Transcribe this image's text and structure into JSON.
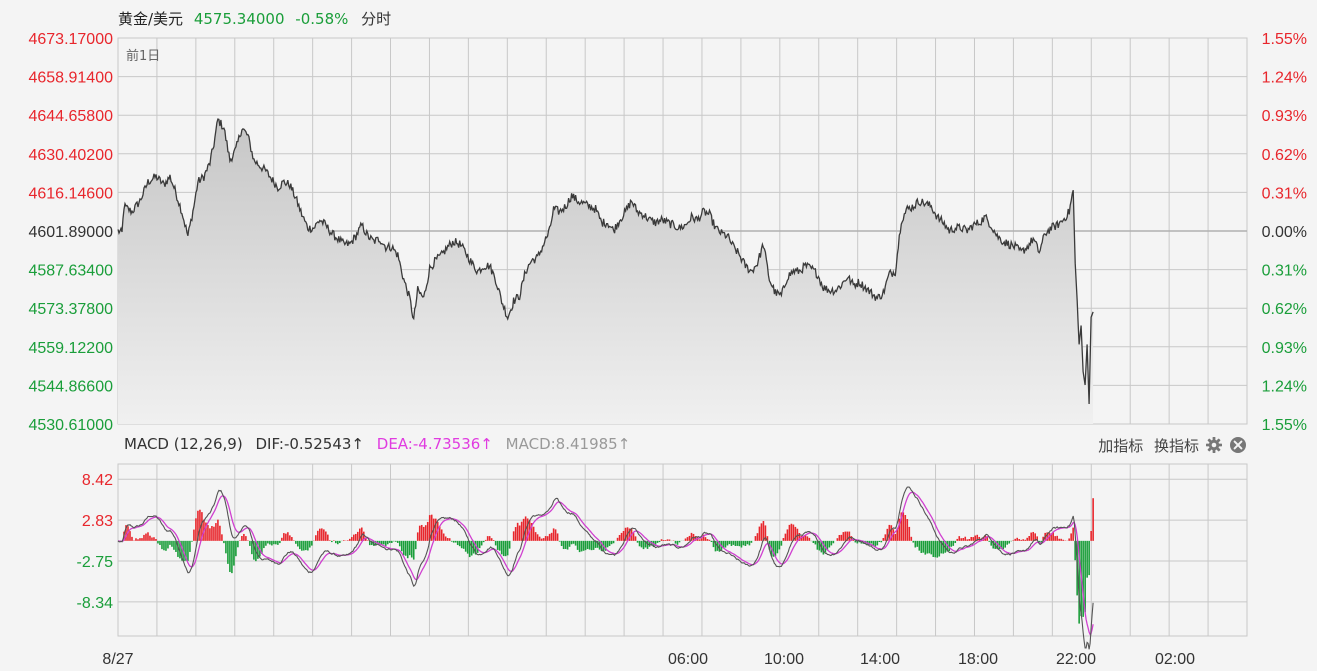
{
  "header": {
    "symbol": "黄金/美元",
    "price": "4575.34000",
    "change_pct": "-0.58%",
    "period": "分时",
    "prev_day_label": "前1日"
  },
  "macd_header": {
    "title": "MACD (12,26,9)",
    "dif": "DIF:-0.52543↑",
    "dea": "DEA:-4.73536↑",
    "macd": "MACD:8.41985↑",
    "add_indicator": "加指标",
    "switch_indicator": "换指标"
  },
  "colors": {
    "up": "#e8262c",
    "down": "#1a9e3a",
    "line": "#3a3a3a",
    "dea": "#d040d0",
    "dif": "#555555",
    "grid": "#c8c8c8"
  },
  "chart_data": [
    {
      "type": "line",
      "name": "price",
      "x_labels": [
        "8/27",
        "06:00",
        "10:00",
        "14:00",
        "18:00",
        "22:00",
        "02:00"
      ],
      "y_ticks_left": [
        "4673.17000",
        "4658.91400",
        "4644.65800",
        "4630.40200",
        "4616.14600",
        "4601.89000",
        "4587.63400",
        "4573.37800",
        "4559.12200",
        "4544.86600",
        "4530.61000"
      ],
      "y_ticks_right": [
        "1.55%",
        "1.24%",
        "0.93%",
        "0.62%",
        "0.31%",
        "0.00%",
        "0.31%",
        "0.62%",
        "0.93%",
        "1.24%",
        "1.55%"
      ],
      "ylim": [
        4530.61,
        4673.17
      ],
      "base": 4601.89,
      "keypoints": [
        [
          0,
          4602
        ],
        [
          4,
          4601
        ],
        [
          6,
          4611
        ],
        [
          14,
          4609
        ],
        [
          22,
          4613
        ],
        [
          30,
          4620
        ],
        [
          38,
          4622
        ],
        [
          46,
          4619
        ],
        [
          52,
          4622
        ],
        [
          58,
          4616
        ],
        [
          64,
          4609
        ],
        [
          70,
          4600
        ],
        [
          76,
          4611
        ],
        [
          80,
          4620
        ],
        [
          86,
          4622
        ],
        [
          92,
          4627
        ],
        [
          96,
          4634
        ],
        [
          100,
          4643
        ],
        [
          106,
          4640
        ],
        [
          112,
          4628
        ],
        [
          118,
          4632
        ],
        [
          124,
          4640
        ],
        [
          130,
          4637
        ],
        [
          136,
          4628
        ],
        [
          142,
          4626
        ],
        [
          148,
          4624
        ],
        [
          154,
          4621
        ],
        [
          160,
          4618
        ],
        [
          166,
          4620
        ],
        [
          172,
          4619
        ],
        [
          178,
          4614
        ],
        [
          184,
          4608
        ],
        [
          190,
          4603
        ],
        [
          196,
          4603
        ],
        [
          202,
          4606
        ],
        [
          208,
          4604
        ],
        [
          214,
          4601
        ],
        [
          220,
          4599
        ],
        [
          226,
          4597
        ],
        [
          232,
          4597
        ],
        [
          238,
          4600
        ],
        [
          244,
          4604
        ],
        [
          250,
          4600
        ],
        [
          256,
          4598
        ],
        [
          262,
          4599
        ],
        [
          268,
          4596
        ],
        [
          274,
          4596
        ],
        [
          280,
          4593
        ],
        [
          286,
          4584
        ],
        [
          292,
          4577
        ],
        [
          296,
          4569
        ],
        [
          300,
          4580
        ],
        [
          306,
          4577
        ],
        [
          312,
          4588
        ],
        [
          318,
          4591
        ],
        [
          324,
          4593
        ],
        [
          330,
          4596
        ],
        [
          336,
          4598
        ],
        [
          342,
          4597
        ],
        [
          348,
          4594
        ],
        [
          354,
          4590
        ],
        [
          360,
          4587
        ],
        [
          366,
          4589
        ],
        [
          372,
          4589
        ],
        [
          378,
          4584
        ],
        [
          384,
          4576
        ],
        [
          390,
          4570
        ],
        [
          396,
          4576
        ],
        [
          402,
          4578
        ],
        [
          408,
          4587
        ],
        [
          414,
          4591
        ],
        [
          420,
          4592
        ],
        [
          426,
          4597
        ],
        [
          432,
          4602
        ],
        [
          436,
          4610
        ],
        [
          442,
          4609
        ],
        [
          448,
          4611
        ],
        [
          454,
          4615
        ],
        [
          460,
          4613
        ],
        [
          466,
          4612
        ],
        [
          472,
          4611
        ],
        [
          478,
          4610
        ],
        [
          484,
          4605
        ],
        [
          490,
          4605
        ],
        [
          496,
          4602
        ],
        [
          502,
          4606
        ],
        [
          508,
          4609
        ],
        [
          514,
          4613
        ],
        [
          520,
          4609
        ],
        [
          526,
          4608
        ],
        [
          532,
          4606
        ],
        [
          538,
          4605
        ],
        [
          544,
          4606
        ],
        [
          550,
          4605
        ],
        [
          556,
          4604
        ],
        [
          562,
          4603
        ],
        [
          568,
          4604
        ],
        [
          574,
          4607
        ],
        [
          580,
          4606
        ],
        [
          586,
          4609
        ],
        [
          592,
          4608
        ],
        [
          598,
          4603
        ],
        [
          604,
          4601
        ],
        [
          610,
          4600
        ],
        [
          616,
          4596
        ],
        [
          622,
          4593
        ],
        [
          628,
          4589
        ],
        [
          634,
          4587
        ],
        [
          640,
          4590
        ],
        [
          646,
          4597
        ],
        [
          652,
          4584
        ],
        [
          658,
          4579
        ],
        [
          664,
          4578
        ],
        [
          670,
          4585
        ],
        [
          676,
          4587
        ],
        [
          682,
          4587
        ],
        [
          688,
          4589
        ],
        [
          694,
          4588
        ],
        [
          700,
          4586
        ],
        [
          706,
          4581
        ],
        [
          712,
          4580
        ],
        [
          718,
          4580
        ],
        [
          724,
          4582
        ],
        [
          730,
          4585
        ],
        [
          736,
          4582
        ],
        [
          742,
          4583
        ],
        [
          748,
          4581
        ],
        [
          754,
          4579
        ],
        [
          760,
          4577
        ],
        [
          766,
          4579
        ],
        [
          772,
          4586
        ],
        [
          778,
          4587
        ],
        [
          784,
          4606
        ],
        [
          790,
          4610
        ],
        [
          796,
          4611
        ],
        [
          802,
          4613
        ],
        [
          808,
          4612
        ],
        [
          814,
          4611
        ],
        [
          820,
          4607
        ],
        [
          826,
          4605
        ],
        [
          832,
          4602
        ],
        [
          838,
          4603
        ],
        [
          844,
          4603
        ],
        [
          850,
          4602
        ],
        [
          856,
          4604
        ],
        [
          862,
          4605
        ],
        [
          868,
          4607
        ],
        [
          874,
          4604
        ],
        [
          880,
          4600
        ],
        [
          886,
          4598
        ],
        [
          892,
          4597
        ],
        [
          898,
          4596
        ],
        [
          904,
          4594
        ],
        [
          910,
          4596
        ],
        [
          916,
          4599
        ],
        [
          922,
          4594
        ],
        [
          928,
          4601
        ],
        [
          934,
          4603
        ],
        [
          940,
          4604
        ],
        [
          946,
          4606
        ],
        [
          952,
          4609
        ],
        [
          956,
          4617
        ],
        [
          958,
          4590
        ],
        [
          960,
          4576
        ],
        [
          962,
          4560
        ],
        [
          964,
          4567
        ],
        [
          966,
          4550
        ],
        [
          968,
          4545
        ],
        [
          970,
          4560
        ],
        [
          972,
          4538
        ],
        [
          974,
          4570
        ],
        [
          976,
          4572
        ]
      ],
      "end_index": 976,
      "total_index": 1130
    },
    {
      "type": "bar",
      "name": "macd",
      "y_ticks": [
        "8.42",
        "2.83",
        "-2.75",
        "-8.34"
      ],
      "ylim": [
        -13.0,
        10.5
      ],
      "series": [
        {
          "name": "DIF",
          "values": []
        },
        {
          "name": "DEA",
          "values": []
        },
        {
          "name": "MACD",
          "values": []
        }
      ]
    }
  ]
}
